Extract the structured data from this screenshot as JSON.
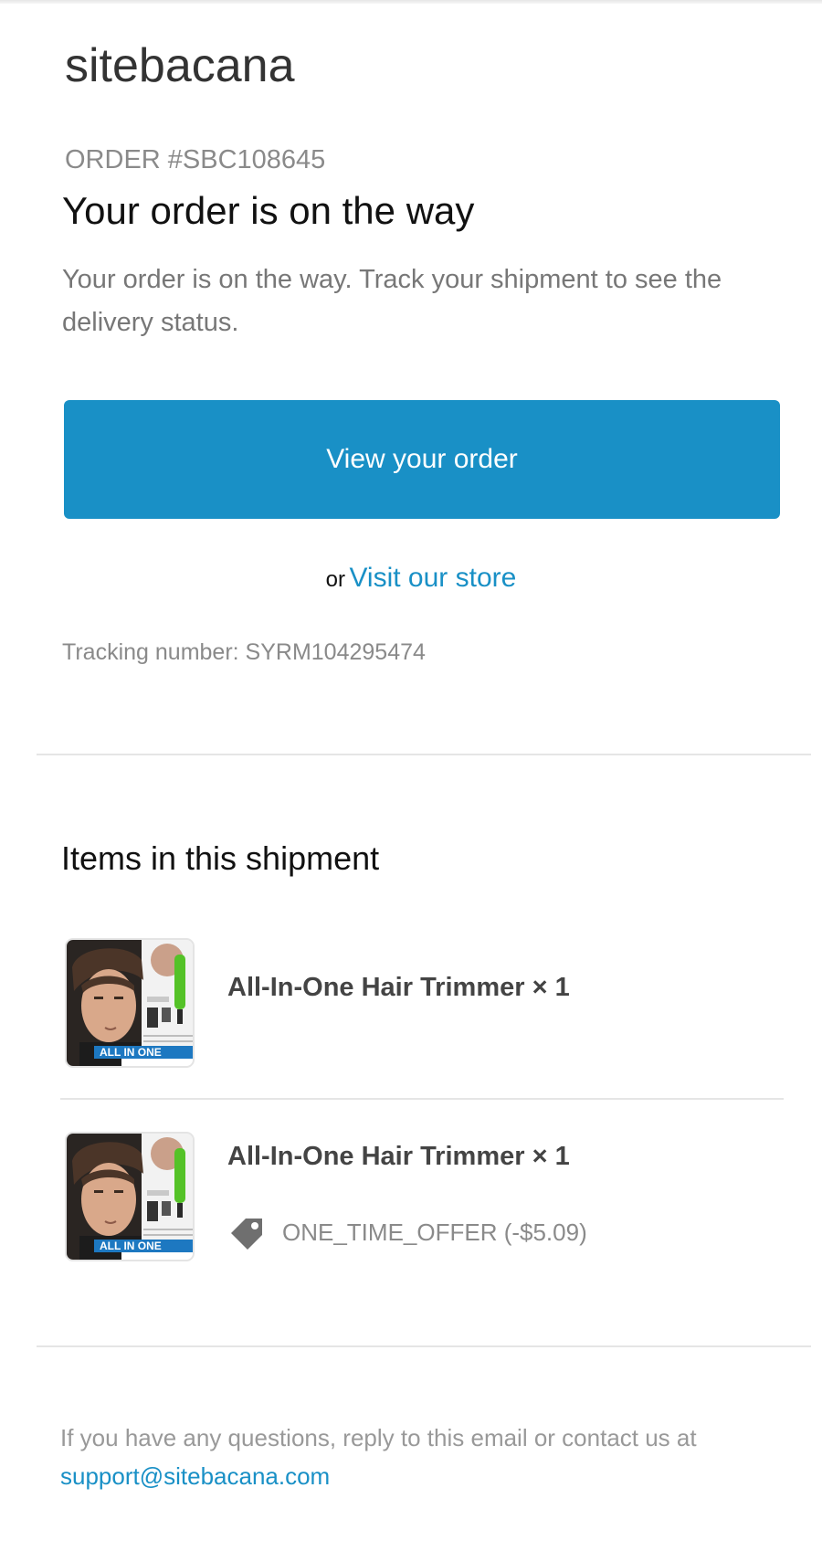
{
  "header": {
    "shop_name": "sitebacana",
    "order_number": "ORDER #SBC108645"
  },
  "main": {
    "headline": "Your order is on the way",
    "intro": "Your order is on the way. Track your shipment to see the delivery status.",
    "view_order_label": "View your order",
    "or_text": "or",
    "store_link_label": "Visit our store",
    "tracking_text": "Tracking number: SYRM104295474"
  },
  "shipment": {
    "title": "Items in this shipment",
    "items": [
      {
        "name": "All-In-One Hair Trimmer × 1",
        "image": "hair-trimmer-product-image"
      },
      {
        "name": "All-In-One Hair Trimmer × 1",
        "image": "hair-trimmer-product-image",
        "discount": "ONE_TIME_OFFER (-$5.09)",
        "discount_icon": "tag-icon"
      }
    ]
  },
  "footer": {
    "text": "If you have any questions, reply to this email or contact us at",
    "support_email": "support@sitebacana.com"
  },
  "colors": {
    "accent": "#1990c6",
    "text_dark": "#111111",
    "text_muted": "#8a8a8a",
    "divider": "#e5e5e5"
  }
}
